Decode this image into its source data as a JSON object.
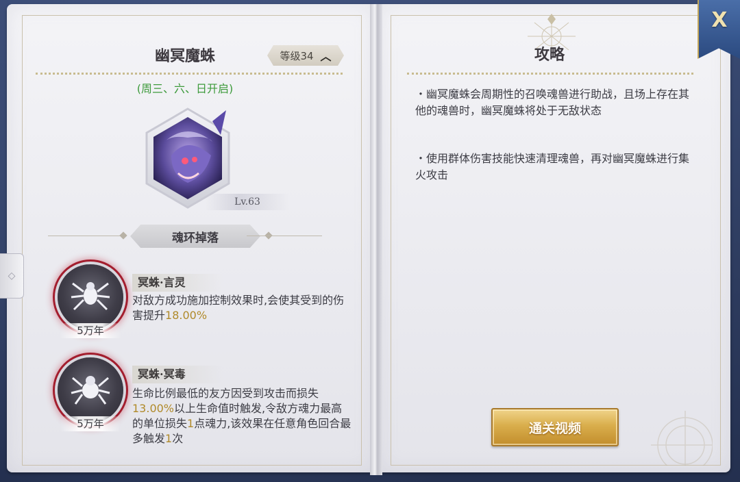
{
  "left_page": {
    "boss_name": "幽冥魔蛛",
    "level_label": "等级34",
    "open_days": "(周三、六、日开启)",
    "boss_level": "Lv.63",
    "section_title": "魂环掉落",
    "rings": [
      {
        "age": "5万年",
        "name": "冥蛛·言灵",
        "desc_parts": [
          "对敌方成功施加控制效果时,会使其受到的伤害提升",
          "18.00%"
        ]
      },
      {
        "age": "5万年",
        "name": "冥蛛·冥毒",
        "desc_parts": [
          "生命比例最低的友方因受到攻击而损失",
          "13.00%",
          "以上生命值时触发,令敌方魂力最高的单位损失",
          "1",
          "点魂力,该效果在任意角色回合最多触发",
          "1",
          "次"
        ]
      }
    ]
  },
  "right_page": {
    "title": "攻略",
    "tips": [
      "・幽冥魔蛛会周期性的召唤魂兽进行助战，且场上存在其他的魂兽时，幽冥魔蛛将处于无敌状态",
      "・使用群体伤害技能快速清理魂兽，再对幽冥魔蛛进行集火攻击"
    ],
    "video_button": "通关视频"
  },
  "close_button": "X",
  "colors": {
    "highlight": "#b08a2a",
    "open_days": "#3d9a3b",
    "button_gold": "#d9ae4c"
  }
}
